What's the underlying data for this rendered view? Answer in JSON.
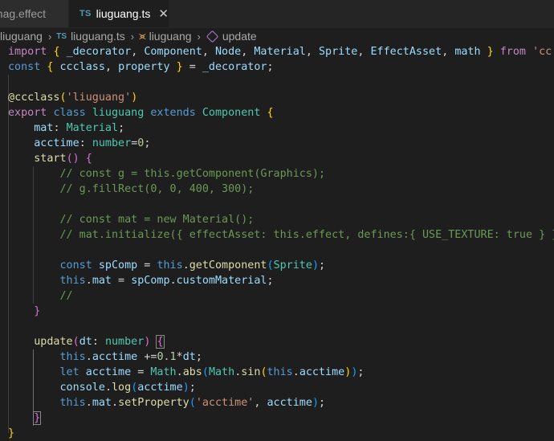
{
  "tabs": [
    {
      "label": "unag.effect",
      "active": false
    },
    {
      "badge": "TS",
      "label": "liuguang.ts",
      "active": true,
      "close": "✕"
    }
  ],
  "breadcrumb": {
    "folder": "liuguang",
    "file_badge": "TS",
    "file": "liuguang.ts",
    "class": "liuguang",
    "method": "update",
    "separator": "›"
  },
  "code": {
    "l1": {
      "import": "import",
      "open": "{",
      "dec": "_decorator",
      "comp": "Component",
      "node": "Node",
      "mat": "Material",
      "sprite": "Sprite",
      "ea": "EffectAsset",
      "math": "math",
      "close": "}",
      "from": "from",
      "mod": "'cc'"
    },
    "l2": {
      "const": "const",
      "open": "{",
      "ccclass": "ccclass",
      "property": "property",
      "close": "}",
      "rhs": "_decorator"
    },
    "l4": {
      "at": "@",
      "fn": "ccclass",
      "arg": "'liuguang'"
    },
    "l5": {
      "export": "export",
      "class": "class",
      "name": "liuguang",
      "extends": "extends",
      "base": "Component",
      "open": "{"
    },
    "l6": {
      "prop": "mat",
      "type": "Material"
    },
    "l7": {
      "prop": "acctime",
      "type": "number",
      "eq": "=",
      "val": "0"
    },
    "l8": {
      "fn": "start",
      "open": "{"
    },
    "l9": "// const g = this.getComponent(Graphics);",
    "l10": "// g.fillRect(0, 0, 400, 300);",
    "l12": "// const mat = new Material();",
    "l13": "// mat.initialize({ effectAsset: this.effect, defines:{ USE_TEXTURE: true } });",
    "l15": {
      "const": "const",
      "var": "spComp",
      "this": "this",
      "fn": "getComponent",
      "arg": "Sprite"
    },
    "l16": {
      "this": "this",
      "prop": "mat",
      "obj": "spComp",
      "member": "customMaterial"
    },
    "l17": "//",
    "l18": "}",
    "l20": {
      "fn": "update",
      "param": "dt",
      "type": "number",
      "open": "{"
    },
    "l21": {
      "this": "this",
      "prop": "acctime",
      "op": "+=",
      "n": "0.1",
      "var": "dt"
    },
    "l22": {
      "let": "let",
      "var": "acctime",
      "cls": "Math",
      "abs": "abs",
      "cls2": "Math",
      "sin": "sin",
      "this": "this",
      "prop": "acctime"
    },
    "l23": {
      "obj": "console",
      "fn": "log",
      "arg": "acctime"
    },
    "l24": {
      "this": "this",
      "prop": "mat",
      "fn": "setProperty",
      "str": "'acctime'",
      "arg": "acctime"
    },
    "l25": "}",
    "l26": "}"
  },
  "colors": {
    "background": "#1e1e1e",
    "keyword_control": "#c586c0",
    "keyword_storage": "#569cd6",
    "variable": "#9cdcfe",
    "type": "#4ec9b0",
    "string": "#ce9178",
    "number": "#b5cea8",
    "function": "#dcdcaa",
    "comment": "#6a9955"
  }
}
